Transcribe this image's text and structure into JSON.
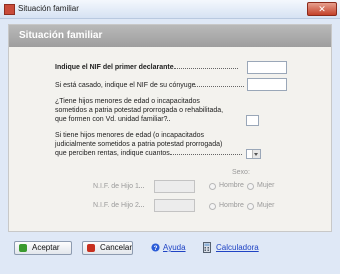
{
  "window": {
    "title": "Situación familiar",
    "close_glyph": "✕"
  },
  "panel": {
    "header": "Situación familiar"
  },
  "form": {
    "nif_first_declarant": {
      "label": "Indique el NIF del primer declarante",
      "value": ""
    },
    "nif_spouse": {
      "label": "Si está casado, indique el NIF de su cónyuge",
      "value": ""
    },
    "children_family_unit": {
      "line1": "¿Tiene hijos menores de edad o incapacitados",
      "line2": "sometidos a patria potestad prorrogada o rehabilitada,",
      "line3": "que formen con Vd. unidad familiar?",
      "checked": false
    },
    "children_income": {
      "line1": "Si tiene hijos menores de edad (o incapacitados",
      "line2": "judicialmente sometidos a patria potestad prorrogada)",
      "line3": "que perciben rentas, indique cuantos",
      "selected": ""
    },
    "sexo_label": "Sexo:",
    "children": [
      {
        "label": "N.I.F. de Hijo 1",
        "value": "",
        "opt1": "Hombre",
        "opt2": "Mujer"
      },
      {
        "label": "N.I.F. de Hijo 2",
        "value": "",
        "opt1": "Hombre",
        "opt2": "Mujer"
      }
    ]
  },
  "footer": {
    "accept": "Aceptar",
    "cancel": "Cancelar",
    "help": "Ayuda",
    "calculator": "Calculadora"
  },
  "colors": {
    "panel_header": "#a9a9a9",
    "link": "#1f43c4",
    "accept_icon": "#3a9a2e",
    "cancel_icon": "#c7301f"
  }
}
